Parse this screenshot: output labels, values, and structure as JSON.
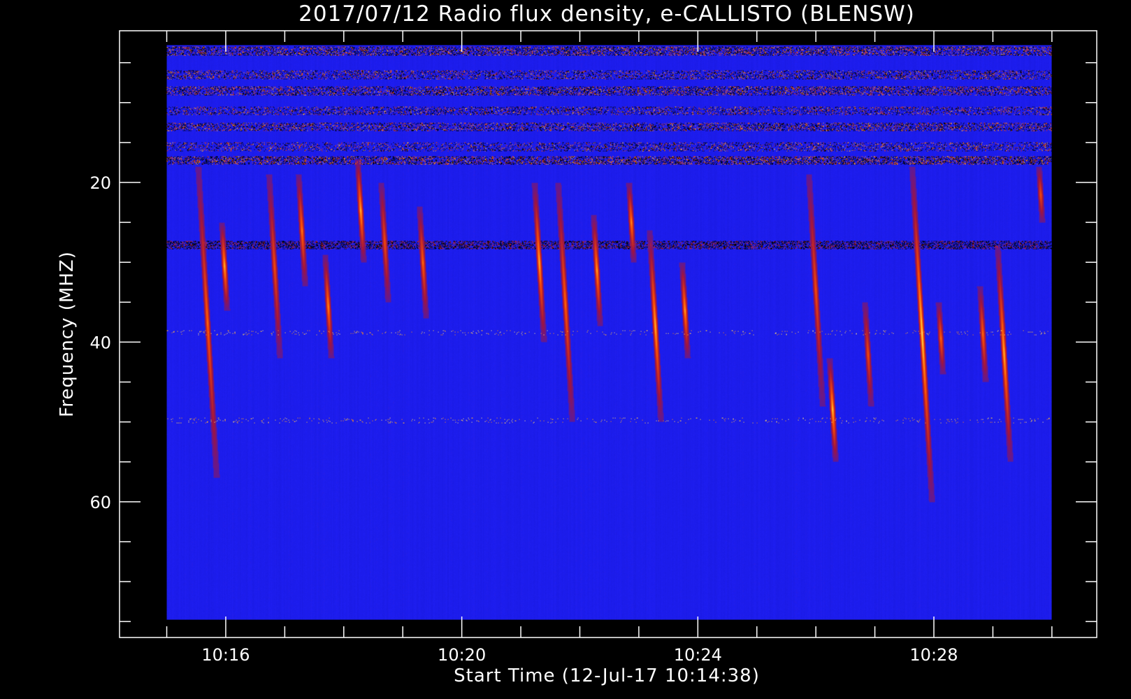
{
  "chart_data": {
    "type": "heatmap",
    "title": "2017/07/12  Radio flux density, e-CALLISTO (BLENSW)",
    "xlabel": "Start Time (12-Jul-17 10:14:38)",
    "ylabel": "Frequency (MHZ)",
    "x_unit": "minutes after 10:14:38 UT",
    "xlim": [
      -0.43,
      16.13
    ],
    "ylim": [
      1,
      77
    ],
    "y_inverted": true,
    "x_major_ticks": [
      {
        "value": 1.37,
        "label": "10:16"
      },
      {
        "value": 5.37,
        "label": "10:20"
      },
      {
        "value": 9.37,
        "label": "10:24"
      },
      {
        "value": 13.37,
        "label": "10:28"
      }
    ],
    "x_minor_ticks": [
      0.37,
      2.37,
      3.37,
      4.37,
      6.37,
      7.37,
      8.37,
      10.37,
      11.37,
      12.37,
      14.37,
      15.37
    ],
    "y_major_ticks": [
      {
        "value": 20,
        "label": "20"
      },
      {
        "value": 40,
        "label": "40"
      },
      {
        "value": 60,
        "label": "60"
      }
    ],
    "y_minor_ticks": [
      5,
      10,
      15,
      25,
      30,
      35,
      45,
      50,
      55,
      65,
      70,
      75
    ],
    "data_extent": {
      "x": [
        0.37,
        15.37
      ],
      "y": [
        2.8,
        74.8
      ]
    },
    "colormap": [
      "#000000",
      "#1e1ef0",
      "#3a1ce0",
      "#a01818",
      "#ff4a00",
      "#ffd040",
      "#ffffff"
    ],
    "background_color": "#1f1ff2",
    "notes_bands": [
      {
        "type": "rfi_band",
        "freq_mhz": 3.5,
        "intensity": 0.8
      },
      {
        "type": "rfi_band",
        "freq_mhz": 6.5,
        "intensity": 0.6
      },
      {
        "type": "rfi_band",
        "freq_mhz": 8.5,
        "intensity": 0.75
      },
      {
        "type": "rfi_band",
        "freq_mhz": 11.0,
        "intensity": 0.55
      },
      {
        "type": "rfi_band",
        "freq_mhz": 13.0,
        "intensity": 0.7
      },
      {
        "type": "rfi_band",
        "freq_mhz": 15.5,
        "intensity": 0.5
      },
      {
        "type": "rfi_band",
        "freq_mhz": 17.2,
        "intensity": 0.9
      },
      {
        "type": "rfi_band",
        "freq_mhz": 27.8,
        "intensity": 0.55
      },
      {
        "type": "spot_band",
        "freq_mhz": 38.8,
        "intensity": 0.6
      },
      {
        "type": "spot_band",
        "freq_mhz": 49.8,
        "intensity": 0.6
      }
    ],
    "bursts": [
      {
        "t": 0.9,
        "f_start": 18,
        "f_end": 57,
        "peak": 0.7
      },
      {
        "t": 1.3,
        "f_start": 25,
        "f_end": 36,
        "peak": 0.9
      },
      {
        "t": 2.1,
        "f_start": 19,
        "f_end": 42,
        "peak": 0.6
      },
      {
        "t": 2.6,
        "f_start": 19,
        "f_end": 33,
        "peak": 0.75
      },
      {
        "t": 3.05,
        "f_start": 29,
        "f_end": 42,
        "peak": 0.8
      },
      {
        "t": 3.6,
        "f_start": 17,
        "f_end": 30,
        "peak": 0.9
      },
      {
        "t": 4.0,
        "f_start": 20,
        "f_end": 35,
        "peak": 0.6
      },
      {
        "t": 4.65,
        "f_start": 23,
        "f_end": 37,
        "peak": 0.7
      },
      {
        "t": 6.6,
        "f_start": 20,
        "f_end": 40,
        "peak": 0.9
      },
      {
        "t": 7.0,
        "f_start": 20,
        "f_end": 50,
        "peak": 0.7
      },
      {
        "t": 7.6,
        "f_start": 24,
        "f_end": 38,
        "peak": 0.85
      },
      {
        "t": 8.2,
        "f_start": 20,
        "f_end": 30,
        "peak": 0.8
      },
      {
        "t": 8.55,
        "f_start": 26,
        "f_end": 50,
        "peak": 0.9
      },
      {
        "t": 9.1,
        "f_start": 30,
        "f_end": 42,
        "peak": 0.85
      },
      {
        "t": 11.25,
        "f_start": 19,
        "f_end": 48,
        "peak": 0.6
      },
      {
        "t": 11.6,
        "f_start": 42,
        "f_end": 55,
        "peak": 0.95
      },
      {
        "t": 12.2,
        "f_start": 35,
        "f_end": 48,
        "peak": 0.6
      },
      {
        "t": 13.0,
        "f_start": 18,
        "f_end": 60,
        "peak": 1.0
      },
      {
        "t": 13.45,
        "f_start": 35,
        "f_end": 44,
        "peak": 0.7
      },
      {
        "t": 14.15,
        "f_start": 33,
        "f_end": 45,
        "peak": 0.7
      },
      {
        "t": 14.45,
        "f_start": 28,
        "f_end": 55,
        "peak": 0.9
      },
      {
        "t": 15.15,
        "f_start": 18,
        "f_end": 25,
        "peak": 0.6
      }
    ]
  }
}
